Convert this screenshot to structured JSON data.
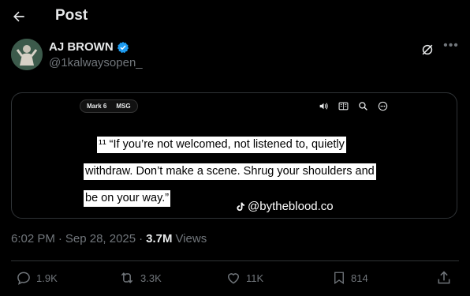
{
  "header": {
    "title": "Post"
  },
  "author": {
    "name": "AJ BROWN",
    "handle": "@1kalwaysopen_"
  },
  "media": {
    "chips": [
      "Mark 6",
      "MSG"
    ],
    "caption_lines": [
      "¹¹ “If you’re not welcomed, not listened to, quietly",
      "withdraw. Don’t make a scene. Shrug your shoulders and",
      "be on your way.”"
    ],
    "watermark": "@bytheblood.co"
  },
  "meta": {
    "time": "6:02 PM",
    "date": "Sep 28, 2025",
    "views_count": "3.7M",
    "views_label": "Views"
  },
  "actions": {
    "replies": "1.9K",
    "reposts": "3.3K",
    "likes": "11K",
    "bookmarks": "814"
  },
  "colors": {
    "background": "#000000",
    "verified": "#1d9bf0",
    "muted": "#71767b"
  }
}
